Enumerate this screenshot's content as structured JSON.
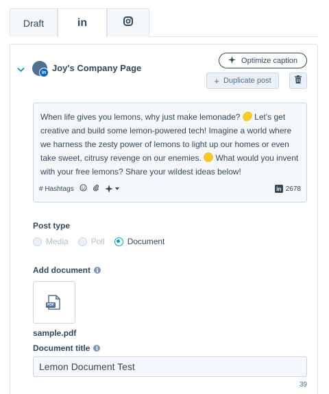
{
  "tabs": [
    {
      "label": "Draft",
      "icon": "none"
    },
    {
      "label": "in",
      "icon": "linkedin-icon",
      "active": true
    },
    {
      "label": "",
      "icon": "instagram-icon"
    }
  ],
  "account": {
    "name": "Joy's Company Page"
  },
  "actions": {
    "optimize_label": "Optimize caption",
    "duplicate_label": "Duplicate post"
  },
  "editor": {
    "text_1": "When life gives you lemons, why just make lemonade?",
    "text_2": " Let's get creative and build some lemon-powered tech! Imagine a world where we harness the zesty power of lemons to light up our homes or even take sweet, citrusy revenge on our enemies.",
    "text_3": " What would you invent with your free lemons? Share your wildest ideas below!",
    "hashtags_label": "# Hashtags",
    "char_count": "2678"
  },
  "post_type": {
    "label": "Post type",
    "options": [
      {
        "label": "Media",
        "selected": false,
        "disabled": true
      },
      {
        "label": "Poll",
        "selected": false,
        "disabled": true
      },
      {
        "label": "Document",
        "selected": true,
        "disabled": false
      }
    ]
  },
  "document": {
    "add_label": "Add document",
    "file_name": "sample.pdf",
    "thumb_badge": "PDF",
    "title_label": "Document title",
    "title_value": "Lemon Document Test",
    "chars_remaining": "39"
  },
  "colors": {
    "text": "#33475b",
    "accent": "#00a4bd",
    "linkedin": "#0a66c2",
    "border": "#cbd6e2"
  }
}
